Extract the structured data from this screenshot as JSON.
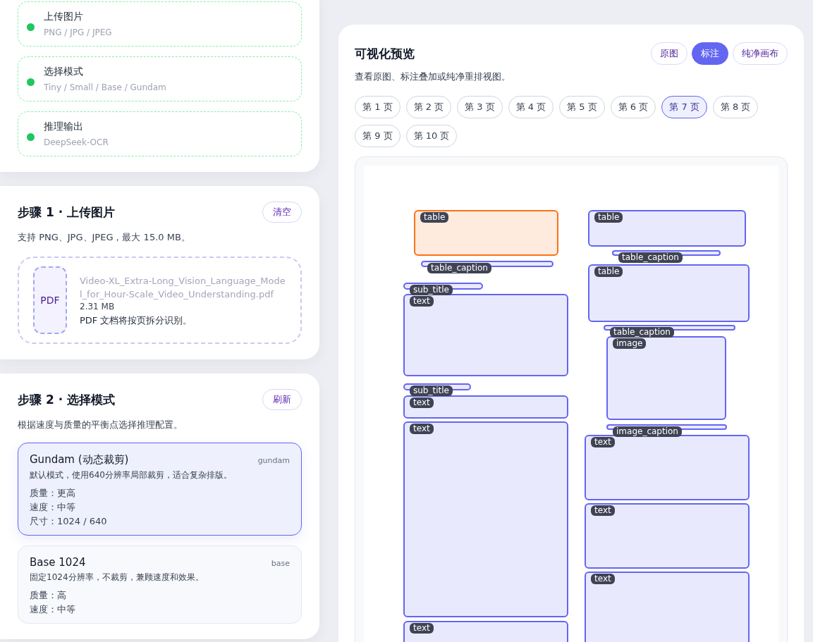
{
  "pipeline": [
    {
      "title": "上传图片",
      "subtitle": "PNG / JPG / JPEG"
    },
    {
      "title": "选择模式",
      "subtitle": "Tiny / Small / Base / Gundam"
    },
    {
      "title": "推理输出",
      "subtitle": "DeepSeek-OCR"
    }
  ],
  "step1": {
    "title": "步骤 1 · 上传图片",
    "action": "清空",
    "description": "支持 PNG、JPG、JPEG，最大 15.0 MB。",
    "upload": {
      "file_badge": "PDF",
      "file_name": "Video-XL_Extra-Long_Vision_Language_Model_for_Hour-Scale_Video_Understanding.pdf",
      "file_size": "2.31 MB",
      "hint": "PDF 文档将按页拆分识别。"
    }
  },
  "step2": {
    "title": "步骤 2 · 选择模式",
    "action": "刷新",
    "description": "根据速度与质量的平衡点选择推理配置。",
    "modes": [
      {
        "name": "Gundam (动态裁剪)",
        "tag": "gundam",
        "description": "默认模式，使用640分辨率局部裁剪，适合复杂排版。",
        "specs": [
          "质量：更高",
          "速度：中等",
          "尺寸：1024 / 640"
        ],
        "selected": true
      },
      {
        "name": "Base 1024",
        "tag": "base",
        "description": "固定1024分辨率，不裁剪，兼顾速度和效果。",
        "specs": [
          "质量：高",
          "速度：中等"
        ],
        "selected": false
      }
    ]
  },
  "preview": {
    "title": "可视化预览",
    "description": "查看原图、标注叠加或纯净重排视图。",
    "views": [
      {
        "label": "原图",
        "selected": false
      },
      {
        "label": "标注",
        "selected": true
      },
      {
        "label": "纯净画布",
        "selected": false
      }
    ],
    "pages": [
      {
        "label": "第 1 页",
        "selected": false
      },
      {
        "label": "第 2 页",
        "selected": false
      },
      {
        "label": "第 3 页",
        "selected": false
      },
      {
        "label": "第 4 页",
        "selected": false
      },
      {
        "label": "第 5 页",
        "selected": false
      },
      {
        "label": "第 6 页",
        "selected": false
      },
      {
        "label": "第 7 页",
        "selected": true
      },
      {
        "label": "第 8 页",
        "selected": false
      },
      {
        "label": "第 9 页",
        "selected": false
      },
      {
        "label": "第 10 页",
        "selected": false
      }
    ],
    "regions": [
      {
        "label": "table",
        "color": "#f97316"
      },
      {
        "label": "table_caption",
        "color": "#6366f1"
      },
      {
        "label": "sub_title",
        "color": "#6366f1"
      },
      {
        "label": "text",
        "color": "#6366f1"
      },
      {
        "label": "sub_title",
        "color": "#6366f1"
      },
      {
        "label": "text",
        "color": "#6366f1"
      },
      {
        "label": "text",
        "color": "#6366f1"
      },
      {
        "label": "text",
        "color": "#6366f1"
      },
      {
        "label": "table",
        "color": "#6366f1"
      },
      {
        "label": "table_caption",
        "color": "#6366f1"
      },
      {
        "label": "table",
        "color": "#6366f1"
      },
      {
        "label": "table_caption",
        "color": "#6366f1"
      },
      {
        "label": "image",
        "color": "#6366f1"
      },
      {
        "label": "image_caption",
        "color": "#6366f1"
      },
      {
        "label": "text",
        "color": "#6366f1"
      },
      {
        "label": "text",
        "color": "#6366f1"
      },
      {
        "label": "text",
        "color": "#6366f1"
      }
    ]
  }
}
